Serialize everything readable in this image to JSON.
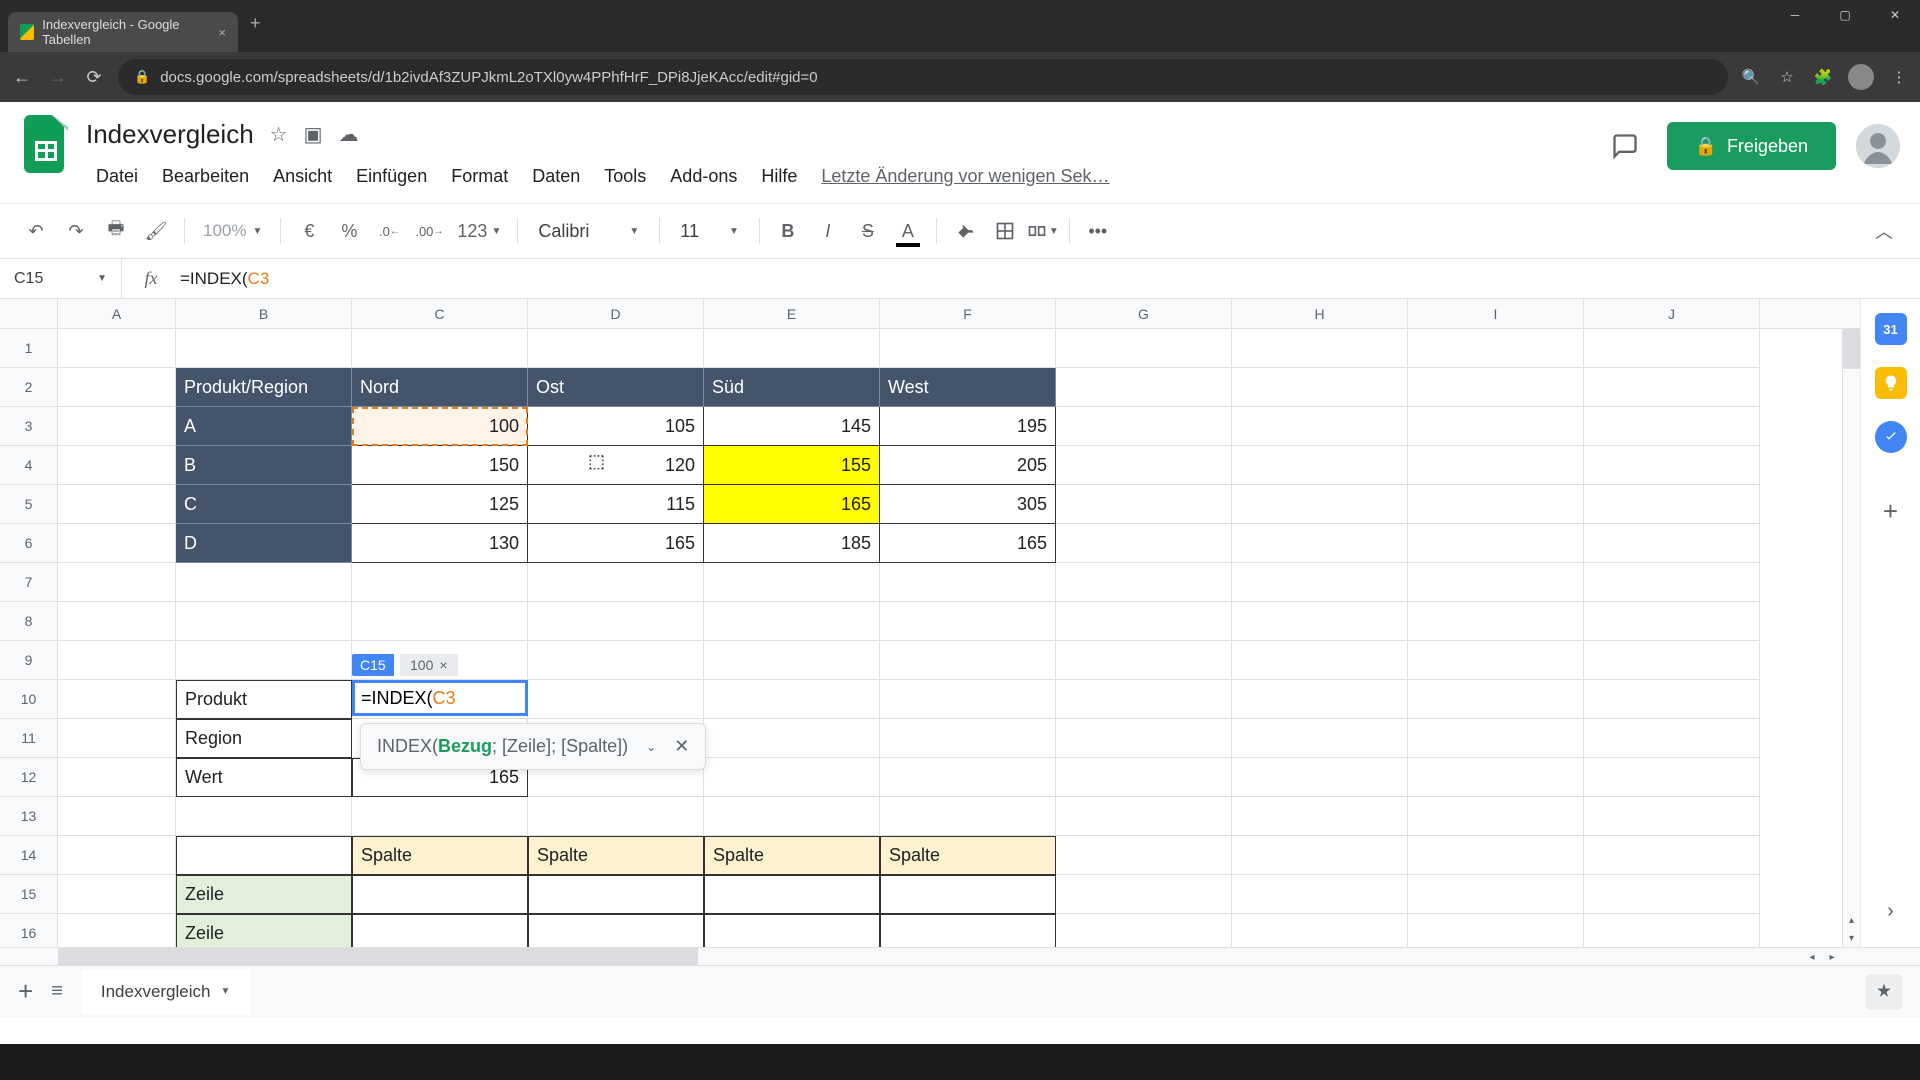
{
  "browser": {
    "tab_title": "Indexvergleich - Google Tabellen",
    "url": "docs.google.com/spreadsheets/d/1b2ivdAf3ZUPJkmL2oTXl0yw4PPhfHrF_DPi8JjeKAcc/edit#gid=0"
  },
  "doc": {
    "title": "Indexvergleich",
    "last_edit": "Letzte Änderung vor wenigen Sek…"
  },
  "menus": [
    "Datei",
    "Bearbeiten",
    "Ansicht",
    "Einfügen",
    "Format",
    "Daten",
    "Tools",
    "Add-ons",
    "Hilfe"
  ],
  "share_label": "Freigeben",
  "toolbar": {
    "zoom": "100%",
    "currency": "€",
    "percent": "%",
    "dec_less": ".0",
    "dec_more": ".00",
    "num_fmt": "123",
    "font": "Calibri",
    "size": "11",
    "more": "•••"
  },
  "name_box": "C15",
  "formula_prefix": "=INDEX(",
  "formula_ref": "C3",
  "col_headers": [
    "A",
    "B",
    "C",
    "D",
    "E",
    "F",
    "G",
    "H",
    "I",
    "J"
  ],
  "row_headers": [
    "1",
    "2",
    "3",
    "4",
    "5",
    "6",
    "7",
    "8",
    "9",
    "10",
    "11",
    "12",
    "13",
    "14",
    "15",
    "16"
  ],
  "table": {
    "corner": "Produkt/Region",
    "regions": [
      "Nord",
      "Ost",
      "Süd",
      "West"
    ],
    "products": [
      "A",
      "B",
      "C",
      "D"
    ],
    "data": [
      [
        100,
        105,
        145,
        195
      ],
      [
        150,
        120,
        155,
        205
      ],
      [
        125,
        115,
        165,
        305
      ],
      [
        130,
        165,
        185,
        165
      ]
    ]
  },
  "lookup": {
    "produkt_label": "Produkt",
    "region_label": "Region",
    "wert_label": "Wert",
    "wert_value": "165"
  },
  "matrix": {
    "spalte": "Spalte",
    "zeile": "Zeile"
  },
  "active": {
    "badge": "C15",
    "preview": "100",
    "formula_prefix": "=INDEX(",
    "formula_ref": "C3"
  },
  "tooltip": {
    "fn": "INDEX(",
    "arg1": "Bezug",
    "sep1": ";",
    "arg2": "[Zeile];",
    "arg3": "[Spalte])"
  },
  "sheet_tab": "Indexvergleich",
  "side_cal": "31"
}
